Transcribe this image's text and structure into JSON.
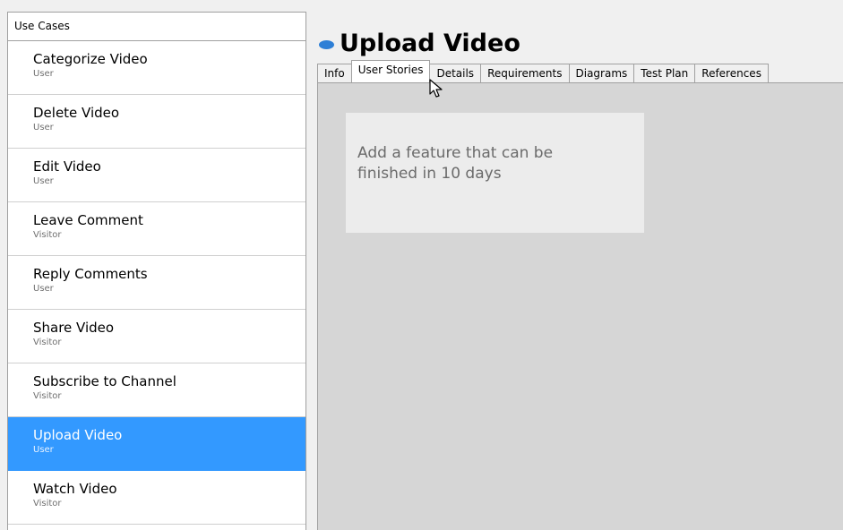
{
  "left_panel": {
    "header": "Use Cases",
    "items": [
      {
        "name": "Categorize Video",
        "actor": "User"
      },
      {
        "name": "Delete Video",
        "actor": "User"
      },
      {
        "name": "Edit Video",
        "actor": "User"
      },
      {
        "name": "Leave Comment",
        "actor": "Visitor"
      },
      {
        "name": "Reply Comments",
        "actor": "User"
      },
      {
        "name": "Share Video",
        "actor": "Visitor"
      },
      {
        "name": "Subscribe to Channel",
        "actor": "Visitor"
      },
      {
        "name": "Upload Video",
        "actor": "User"
      },
      {
        "name": "Watch Video",
        "actor": "Visitor"
      }
    ],
    "selected_index": 7,
    "selected_color": "#3399ff"
  },
  "detail": {
    "title": "Upload Video",
    "title_icon": "use-case-ellipse-icon",
    "title_icon_color": "#2e7fd6",
    "tabs": [
      {
        "label": "Info"
      },
      {
        "label": "User Stories"
      },
      {
        "label": "Details"
      },
      {
        "label": "Requirements"
      },
      {
        "label": "Diagrams"
      },
      {
        "label": "Test Plan"
      },
      {
        "label": "References"
      }
    ],
    "active_tab_index": 1,
    "user_story_placeholder": "Add a feature that can be finished in 10 days"
  },
  "cursor": "arrow-cursor-icon"
}
